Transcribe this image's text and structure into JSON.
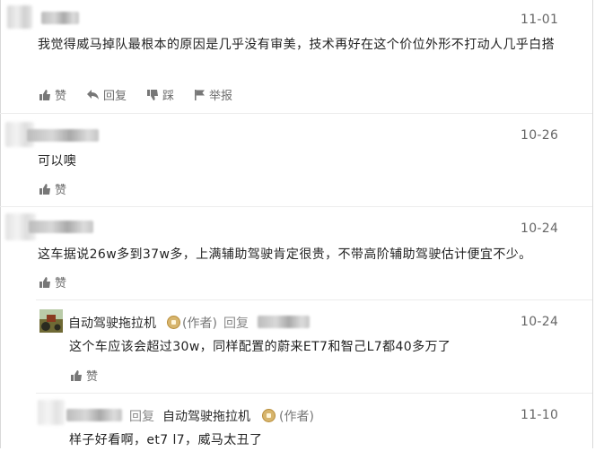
{
  "comments": [
    {
      "date": "11-01",
      "text": "我觉得威马掉队最根本的原因是几乎没有审美，技术再好在这个价位外形不打动人几乎白搭",
      "actions": {
        "like": "赞",
        "reply": "回复",
        "dislike": "踩",
        "report": "举报"
      }
    },
    {
      "date": "10-26",
      "text": "可以噢",
      "actions": {
        "like": "赞"
      }
    },
    {
      "date": "10-24",
      "text": "这车据说26w多到37w多，上满辅助驾驶肯定很贵，不带高阶辅助驾驶估计便宜不少。",
      "actions": {
        "like": "赞"
      }
    }
  ],
  "replies": [
    {
      "username": "自动驾驶拖拉机",
      "author_tag": "(作者)",
      "reply_word": "回复",
      "date": "10-24",
      "text": "这个车应该会超过30w，同样配置的蔚来ET7和智己L7都40多万了",
      "actions": {
        "like": "赞"
      }
    },
    {
      "reply_word": "回复",
      "reply_to_username": "自动驾驶拖拉机",
      "author_tag": "(作者)",
      "date": "11-10",
      "text": "样子好看啊，et7 l7，威马太丑了"
    }
  ],
  "colors": {
    "text": "#222222",
    "muted": "#6d6d6d",
    "divider": "#ececec",
    "badge": "#d7b56d"
  },
  "icons": [
    "thumbs-up-icon",
    "reply-arrow-icon",
    "thumbs-down-icon",
    "flag-icon",
    "gold-badge-icon"
  ]
}
